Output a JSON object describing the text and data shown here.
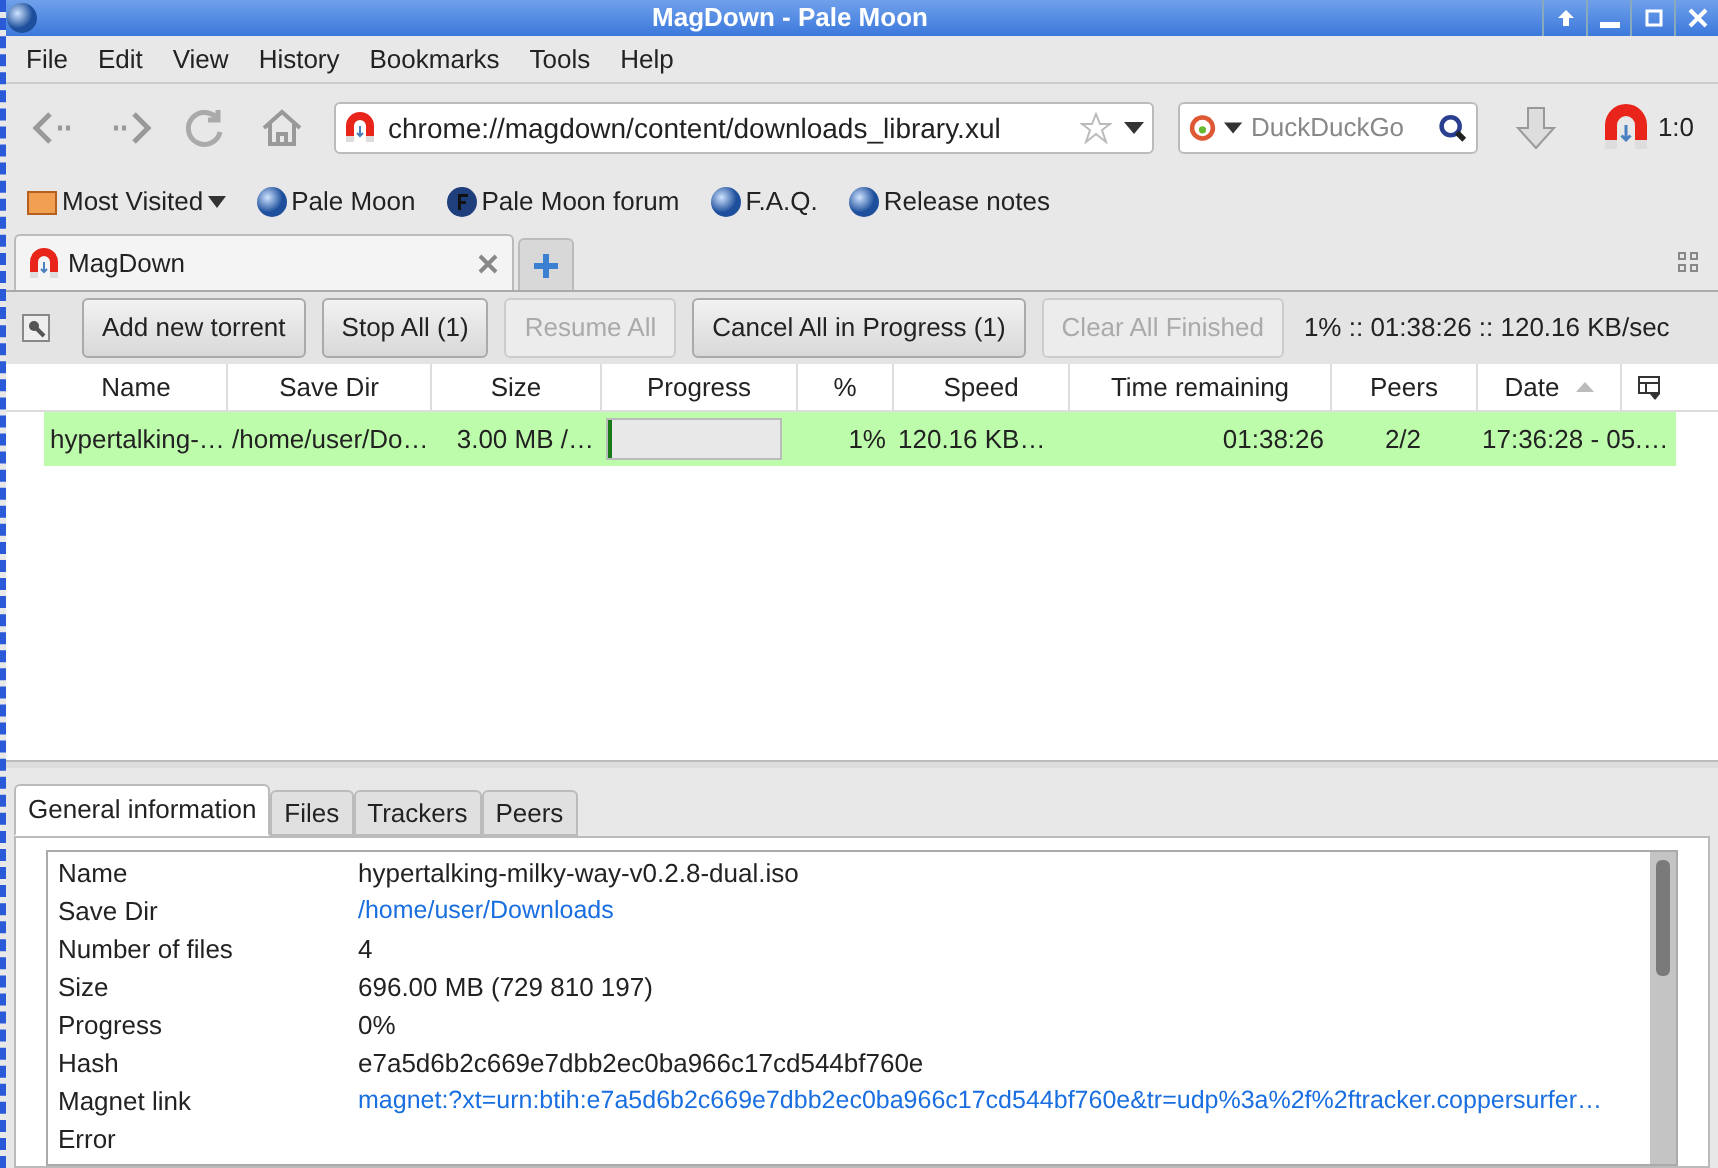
{
  "window": {
    "title": "MagDown - Pale Moon"
  },
  "menu": [
    "File",
    "Edit",
    "View",
    "History",
    "Bookmarks",
    "Tools",
    "Help"
  ],
  "address": {
    "value": "chrome://magdown/content/downloads_library.xul"
  },
  "search": {
    "placeholder": "DuckDuckGo"
  },
  "addon_counter": "1:0",
  "bookmarks": [
    {
      "label": "Most Visited",
      "kind": "folder"
    },
    {
      "label": "Pale Moon",
      "kind": "globe"
    },
    {
      "label": "Pale Moon forum",
      "kind": "forum"
    },
    {
      "label": "F.A.Q.",
      "kind": "globe"
    },
    {
      "label": "Release notes",
      "kind": "globe"
    }
  ],
  "browser_tabs": [
    {
      "label": "MagDown",
      "selected": true
    }
  ],
  "toolbar": {
    "buttons": [
      {
        "label": "Add new torrent",
        "disabled": false
      },
      {
        "label": "Stop All (1)",
        "disabled": false
      },
      {
        "label": "Resume All",
        "disabled": true
      },
      {
        "label": "Cancel All in Progress (1)",
        "disabled": false
      },
      {
        "label": "Clear All Finished",
        "disabled": true
      }
    ],
    "status": "1% :: 01:38:26 :: 120.16 KB/sec"
  },
  "table": {
    "columns": [
      "Name",
      "Save Dir",
      "Size",
      "Progress",
      "%",
      "Speed",
      "Time remaining",
      "Peers",
      "Date"
    ],
    "rows": [
      {
        "selected": true,
        "name": "hypertalking-…",
        "save_dir": "/home/user/Do…",
        "size": "3.00 MB /…",
        "level": 0.01,
        "percent": "1%",
        "speed": "120.16 KB…",
        "time_remaining": "01:38:26",
        "peers": "2/2",
        "date": "17:36:28 - 05.…"
      }
    ]
  },
  "detail_tabs": [
    {
      "label": "General information",
      "selected": true
    },
    {
      "label": "Files",
      "selected": false
    },
    {
      "label": "Trackers",
      "selected": false
    },
    {
      "label": "Peers",
      "selected": false
    }
  ],
  "details": [
    {
      "label": "Name",
      "value": "hypertalking-milky-way-v0.2.8-dual.iso",
      "kind": "text"
    },
    {
      "label": "Save Dir",
      "value": "/home/user/Downloads",
      "kind": "link"
    },
    {
      "label": "Number of files",
      "value": "4",
      "kind": "text"
    },
    {
      "label": "Size",
      "value": "696.00 MB (729 810 197)",
      "kind": "text"
    },
    {
      "label": "Progress",
      "value": "0%",
      "kind": "text"
    },
    {
      "label": "Hash",
      "value": "e7a5d6b2c669e7dbb2ec0ba966c17cd544bf760e",
      "kind": "text"
    },
    {
      "label": "Magnet link",
      "value": "magnet:?xt=urn:btih:e7a5d6b2c669e7dbb2ec0ba966c17cd544bf760e&tr=udp%3a%2f%2ftracker.coppersurfer…",
      "kind": "link"
    },
    {
      "label": "Error",
      "kind": "text"
    }
  ]
}
